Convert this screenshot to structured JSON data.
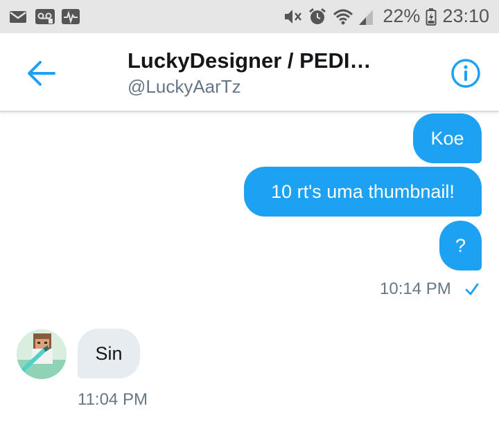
{
  "status_bar": {
    "battery": "22%",
    "time": "23:10"
  },
  "header": {
    "title": "LuckyDesigner / PEDI…",
    "handle": "@LuckyAarTz"
  },
  "messages": [
    {
      "direction": "outgoing",
      "text": "Koe"
    },
    {
      "direction": "outgoing",
      "text": "10 rt's uma thumbnail!"
    },
    {
      "direction": "outgoing",
      "text": "?"
    },
    {
      "direction": "outgoing_timestamp",
      "text": "10:14 PM"
    },
    {
      "direction": "incoming",
      "text": "Sin"
    },
    {
      "direction": "incoming_timestamp",
      "text": "11:04 PM"
    }
  ],
  "colors": {
    "accent": "#1da1f2",
    "incoming_bubble": "#e6ecf0",
    "secondary_text": "#657786"
  },
  "icons": [
    "mail-icon",
    "voicemail-icon",
    "activity-icon",
    "mute-icon",
    "alarm-icon",
    "wifi-icon",
    "signal-icon",
    "battery-icon",
    "back-arrow-icon",
    "info-icon",
    "read-check-icon"
  ]
}
